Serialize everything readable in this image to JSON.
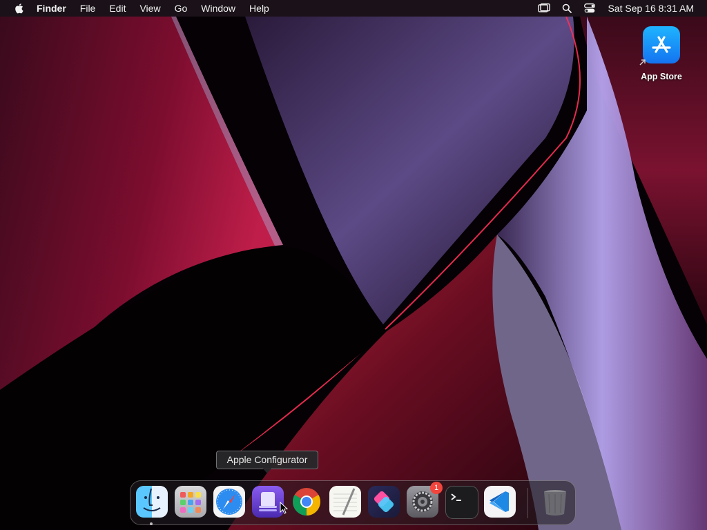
{
  "menubar": {
    "app_name": "Finder",
    "menus": [
      "File",
      "Edit",
      "View",
      "Go",
      "Window",
      "Help"
    ],
    "status_icons": [
      "screen-mirroring-icon",
      "spotlight-search-icon",
      "control-center-icon"
    ],
    "clock": "Sat Sep 16  8:31 AM"
  },
  "desktop": {
    "icons": [
      {
        "label": "App Store",
        "icon": "app-store-icon",
        "is_alias": true
      }
    ]
  },
  "dock": {
    "tooltip": "Apple Configurator",
    "items": [
      {
        "icon": "finder-icon",
        "running": true
      },
      {
        "icon": "launchpad-icon"
      },
      {
        "icon": "safari-icon"
      },
      {
        "icon": "apple-configurator-icon"
      },
      {
        "icon": "chrome-icon"
      },
      {
        "icon": "textedit-icon"
      },
      {
        "icon": "shortcuts-icon"
      },
      {
        "icon": "system-settings-icon",
        "badge": "1"
      },
      {
        "icon": "terminal-icon"
      },
      {
        "icon": "vscode-icon"
      },
      {
        "icon": "trash-icon"
      }
    ]
  },
  "colors": {
    "wallpaper_red": "#a5133f",
    "wallpaper_violet": "#b6a4ee",
    "badge_red": "#f2453d",
    "app_store_blue": "#1677f3"
  }
}
